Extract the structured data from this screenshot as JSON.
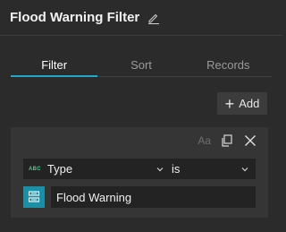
{
  "header": {
    "title": "Flood Warning Filter",
    "edit_icon": "pencil-icon"
  },
  "tabs": [
    {
      "label": "Filter",
      "active": true
    },
    {
      "label": "Sort",
      "active": false
    },
    {
      "label": "Records",
      "active": false
    }
  ],
  "toolbar": {
    "add_label": "Add",
    "add_icon": "plus-icon"
  },
  "clause": {
    "tools": {
      "case_sensitive_label": "Aa",
      "duplicate_icon": "copy-icon",
      "remove_icon": "close-icon"
    },
    "field": {
      "type_badge": "ABC",
      "value": "Type"
    },
    "operator": {
      "value": "is"
    },
    "value_source_icon": "unique-values-icon",
    "value": "Flood Warning"
  },
  "colors": {
    "accent": "#22a7c6",
    "field_type_badge": "#4fc98b",
    "value_source": "#1a8fa6"
  }
}
